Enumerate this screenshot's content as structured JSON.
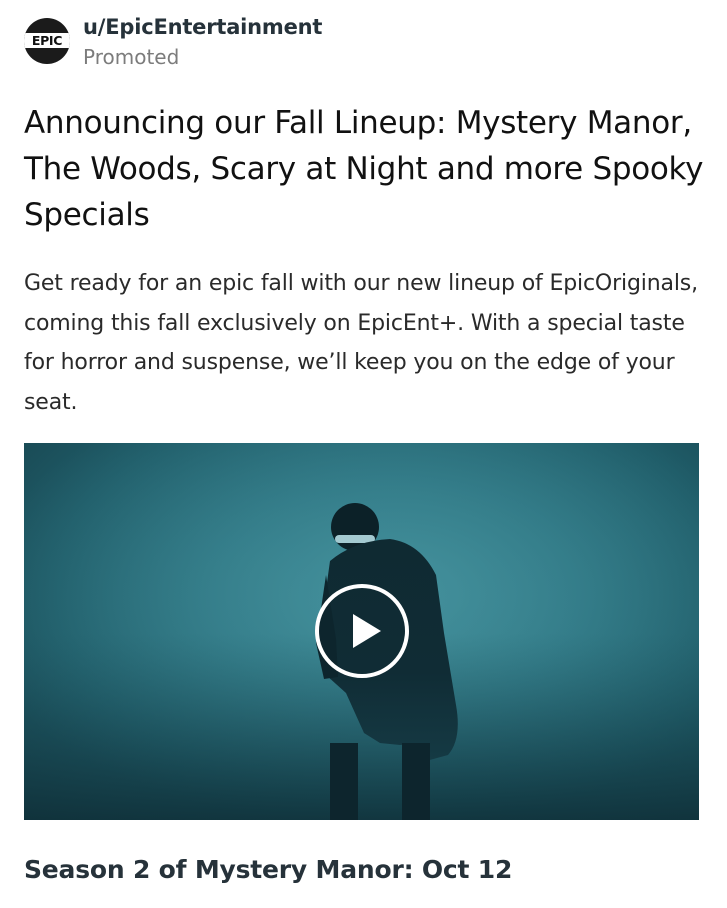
{
  "post": {
    "author": {
      "username": "u/EpicEntertainment",
      "avatar_logo_text": "EPIC",
      "label": "Promoted"
    },
    "title": "Announcing our Fall Lineup: Mystery Manor, The Woods, Scary at Night and more Spooky Specials",
    "body": "Get ready for an epic fall with our new lineup of EpicOriginals, coming this fall exclusively on EpicEnt+. With a special taste for horror and suspense, we’ll keep you on the edge of your seat.",
    "media": {
      "type": "video",
      "play_icon": "play-icon",
      "dominant_color": "#2c7380"
    },
    "caption": "Season 2 of Mystery Manor: Oct 12"
  }
}
